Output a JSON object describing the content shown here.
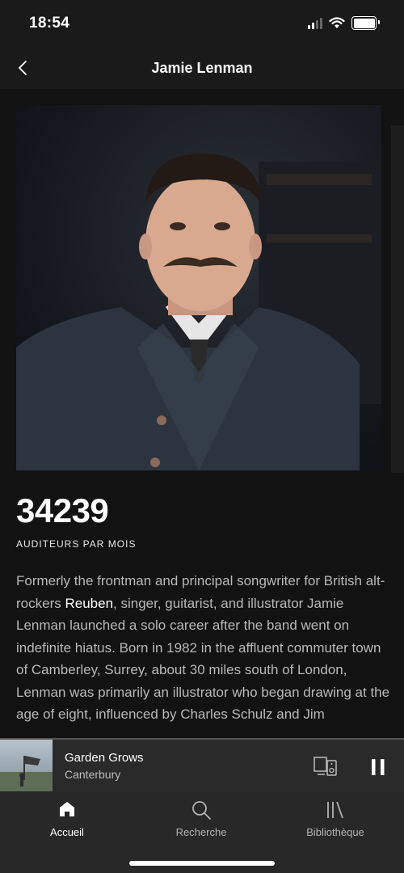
{
  "status_bar": {
    "time": "18:54"
  },
  "header": {
    "title": "Jamie Lenman"
  },
  "artist": {
    "monthly_listeners": "34239",
    "monthly_listeners_label": "AUDITEURS PAR MOIS",
    "bio_before_link": "Formerly the frontman and principal songwriter for British alt-rockers ",
    "bio_link": "Reuben",
    "bio_after_link": ", singer, guitarist, and illustrator Jamie Lenman launched a solo career after the band went on indefinite hiatus. Born in 1982 in the affluent commuter town of Camberley, Surrey, about 30 miles south of London, Lenman was primarily an illustrator who began drawing at the age of eight, influenced by Charles Schulz and Jim"
  },
  "now_playing": {
    "title": "Garden Grows",
    "artist": "Canterbury"
  },
  "bottom_nav": {
    "items": [
      {
        "label": "Accueil",
        "icon": "home-icon",
        "active": true
      },
      {
        "label": "Recherche",
        "icon": "search-icon",
        "active": false
      },
      {
        "label": "Bibliothèque",
        "icon": "library-icon",
        "active": false
      }
    ]
  },
  "colors": {
    "background": "#121212",
    "bar": "#1a1a1a",
    "player": "#2a2a2a",
    "nav": "#282828",
    "secondary_text": "#b3b3b3"
  }
}
